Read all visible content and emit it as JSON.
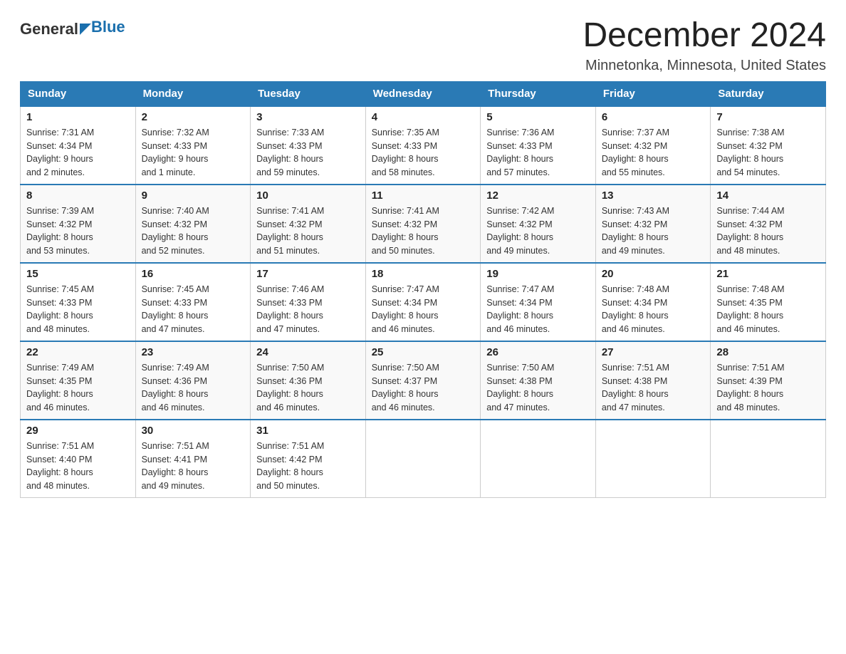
{
  "header": {
    "logo_general": "General",
    "logo_blue": "Blue",
    "month_title": "December 2024",
    "location": "Minnetonka, Minnesota, United States"
  },
  "weekdays": [
    "Sunday",
    "Monday",
    "Tuesday",
    "Wednesday",
    "Thursday",
    "Friday",
    "Saturday"
  ],
  "weeks": [
    [
      {
        "day": "1",
        "sunrise": "7:31 AM",
        "sunset": "4:34 PM",
        "daylight": "9 hours and 2 minutes."
      },
      {
        "day": "2",
        "sunrise": "7:32 AM",
        "sunset": "4:33 PM",
        "daylight": "9 hours and 1 minute."
      },
      {
        "day": "3",
        "sunrise": "7:33 AM",
        "sunset": "4:33 PM",
        "daylight": "8 hours and 59 minutes."
      },
      {
        "day": "4",
        "sunrise": "7:35 AM",
        "sunset": "4:33 PM",
        "daylight": "8 hours and 58 minutes."
      },
      {
        "day": "5",
        "sunrise": "7:36 AM",
        "sunset": "4:33 PM",
        "daylight": "8 hours and 57 minutes."
      },
      {
        "day": "6",
        "sunrise": "7:37 AM",
        "sunset": "4:32 PM",
        "daylight": "8 hours and 55 minutes."
      },
      {
        "day": "7",
        "sunrise": "7:38 AM",
        "sunset": "4:32 PM",
        "daylight": "8 hours and 54 minutes."
      }
    ],
    [
      {
        "day": "8",
        "sunrise": "7:39 AM",
        "sunset": "4:32 PM",
        "daylight": "8 hours and 53 minutes."
      },
      {
        "day": "9",
        "sunrise": "7:40 AM",
        "sunset": "4:32 PM",
        "daylight": "8 hours and 52 minutes."
      },
      {
        "day": "10",
        "sunrise": "7:41 AM",
        "sunset": "4:32 PM",
        "daylight": "8 hours and 51 minutes."
      },
      {
        "day": "11",
        "sunrise": "7:41 AM",
        "sunset": "4:32 PM",
        "daylight": "8 hours and 50 minutes."
      },
      {
        "day": "12",
        "sunrise": "7:42 AM",
        "sunset": "4:32 PM",
        "daylight": "8 hours and 49 minutes."
      },
      {
        "day": "13",
        "sunrise": "7:43 AM",
        "sunset": "4:32 PM",
        "daylight": "8 hours and 49 minutes."
      },
      {
        "day": "14",
        "sunrise": "7:44 AM",
        "sunset": "4:32 PM",
        "daylight": "8 hours and 48 minutes."
      }
    ],
    [
      {
        "day": "15",
        "sunrise": "7:45 AM",
        "sunset": "4:33 PM",
        "daylight": "8 hours and 48 minutes."
      },
      {
        "day": "16",
        "sunrise": "7:45 AM",
        "sunset": "4:33 PM",
        "daylight": "8 hours and 47 minutes."
      },
      {
        "day": "17",
        "sunrise": "7:46 AM",
        "sunset": "4:33 PM",
        "daylight": "8 hours and 47 minutes."
      },
      {
        "day": "18",
        "sunrise": "7:47 AM",
        "sunset": "4:34 PM",
        "daylight": "8 hours and 46 minutes."
      },
      {
        "day": "19",
        "sunrise": "7:47 AM",
        "sunset": "4:34 PM",
        "daylight": "8 hours and 46 minutes."
      },
      {
        "day": "20",
        "sunrise": "7:48 AM",
        "sunset": "4:34 PM",
        "daylight": "8 hours and 46 minutes."
      },
      {
        "day": "21",
        "sunrise": "7:48 AM",
        "sunset": "4:35 PM",
        "daylight": "8 hours and 46 minutes."
      }
    ],
    [
      {
        "day": "22",
        "sunrise": "7:49 AM",
        "sunset": "4:35 PM",
        "daylight": "8 hours and 46 minutes."
      },
      {
        "day": "23",
        "sunrise": "7:49 AM",
        "sunset": "4:36 PM",
        "daylight": "8 hours and 46 minutes."
      },
      {
        "day": "24",
        "sunrise": "7:50 AM",
        "sunset": "4:36 PM",
        "daylight": "8 hours and 46 minutes."
      },
      {
        "day": "25",
        "sunrise": "7:50 AM",
        "sunset": "4:37 PM",
        "daylight": "8 hours and 46 minutes."
      },
      {
        "day": "26",
        "sunrise": "7:50 AM",
        "sunset": "4:38 PM",
        "daylight": "8 hours and 47 minutes."
      },
      {
        "day": "27",
        "sunrise": "7:51 AM",
        "sunset": "4:38 PM",
        "daylight": "8 hours and 47 minutes."
      },
      {
        "day": "28",
        "sunrise": "7:51 AM",
        "sunset": "4:39 PM",
        "daylight": "8 hours and 48 minutes."
      }
    ],
    [
      {
        "day": "29",
        "sunrise": "7:51 AM",
        "sunset": "4:40 PM",
        "daylight": "8 hours and 48 minutes."
      },
      {
        "day": "30",
        "sunrise": "7:51 AM",
        "sunset": "4:41 PM",
        "daylight": "8 hours and 49 minutes."
      },
      {
        "day": "31",
        "sunrise": "7:51 AM",
        "sunset": "4:42 PM",
        "daylight": "8 hours and 50 minutes."
      },
      null,
      null,
      null,
      null
    ]
  ],
  "labels": {
    "sunrise": "Sunrise:",
    "sunset": "Sunset:",
    "daylight": "Daylight:"
  }
}
